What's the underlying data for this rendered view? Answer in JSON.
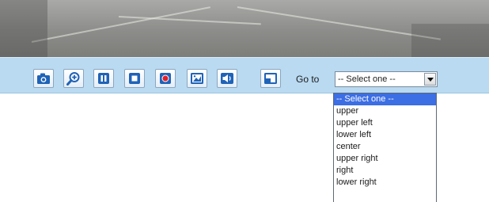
{
  "toolbar": {
    "buttons": [
      {
        "name": "snapshot-button",
        "icon": "camera-icon"
      },
      {
        "name": "zoom-button",
        "icon": "zoom-in-icon"
      },
      {
        "name": "pause-button",
        "icon": "pause-icon"
      },
      {
        "name": "stop-button",
        "icon": "stop-icon"
      },
      {
        "name": "record-button",
        "icon": "record-icon"
      },
      {
        "name": "manual-trigger-button",
        "icon": "trigger-icon"
      },
      {
        "name": "volume-button",
        "icon": "speaker-icon"
      },
      {
        "name": "fullscreen-button",
        "icon": "fullscreen-icon"
      }
    ],
    "goto_label": "Go to",
    "goto_select": {
      "value": "-- Select one --",
      "options": [
        "-- Select one --",
        "upper",
        "upper left",
        "lower left",
        "center",
        "upper right",
        "right",
        "lower right"
      ],
      "highlighted_index": 0
    }
  },
  "colors": {
    "toolbar_bg": "#b9daf1",
    "icon_blue": "#1f63b8",
    "record_red": "#e0202a",
    "highlight": "#3c6ee4"
  }
}
